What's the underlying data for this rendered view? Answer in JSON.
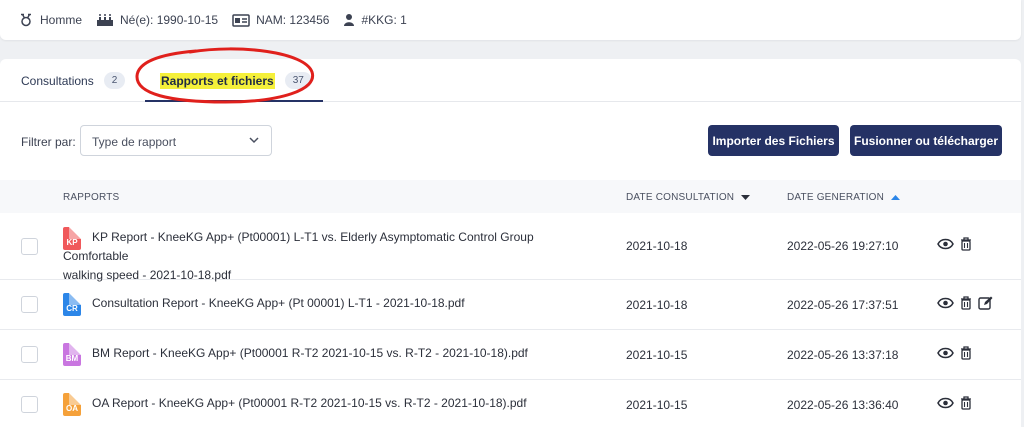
{
  "patient": {
    "sex": "Homme",
    "birth": "Né(e): 1990-10-15",
    "nam": "NAM: 123456",
    "kkg": "#KKG: 1"
  },
  "tabs": [
    {
      "label": "Consultations",
      "count": "2"
    },
    {
      "label": "Rapports et fichiers",
      "count": "37"
    }
  ],
  "filter": {
    "label": "Filtrer par:",
    "value": "Type de rapport"
  },
  "buttons": {
    "import": "Importer des Fichiers",
    "merge": "Fusionner ou télécharger"
  },
  "table": {
    "headers": {
      "reports": "RAPPORTS",
      "date_consultation": "DATE CONSULTATION",
      "date_generation": "DATE GENERATION"
    },
    "rows": [
      {
        "icon": "KP",
        "color": "#f0595b",
        "name_line1": "KP Report - KneeKG App+ (Pt00001) L-T1 vs. Elderly Asymptomatic Control Group Comfortable",
        "name_line2": "walking speed - 2021-10-18.pdf",
        "date_consultation": "2021-10-18",
        "date_generation": "2022-05-26 19:27:10",
        "editable": false
      },
      {
        "icon": "CR",
        "color": "#2c86e8",
        "name_line1": "Consultation Report - KneeKG App+ (Pt 00001) L-T1 - 2021-10-18.pdf",
        "name_line2": "",
        "date_consultation": "2021-10-18",
        "date_generation": "2022-05-26 17:37:51",
        "editable": true
      },
      {
        "icon": "BM",
        "color": "#c976e0",
        "name_line1": "BM Report - KneeKG App+ (Pt00001 R-T2 2021-10-15 vs. R-T2 - 2021-10-18).pdf",
        "name_line2": "",
        "date_consultation": "2021-10-15",
        "date_generation": "2022-05-26 13:37:18",
        "editable": false
      },
      {
        "icon": "OA",
        "color": "#f5a13a",
        "name_line1": "OA Report - KneeKG App+ (Pt00001 R-T2 2021-10-15 vs. R-T2 - 2021-10-18).pdf",
        "name_line2": "",
        "date_consultation": "2021-10-15",
        "date_generation": "2022-05-26 13:36:40",
        "editable": false
      }
    ]
  },
  "colors": {
    "primary": "#253265",
    "highlight": "#f5f03a",
    "annotation": "#e0201c"
  }
}
